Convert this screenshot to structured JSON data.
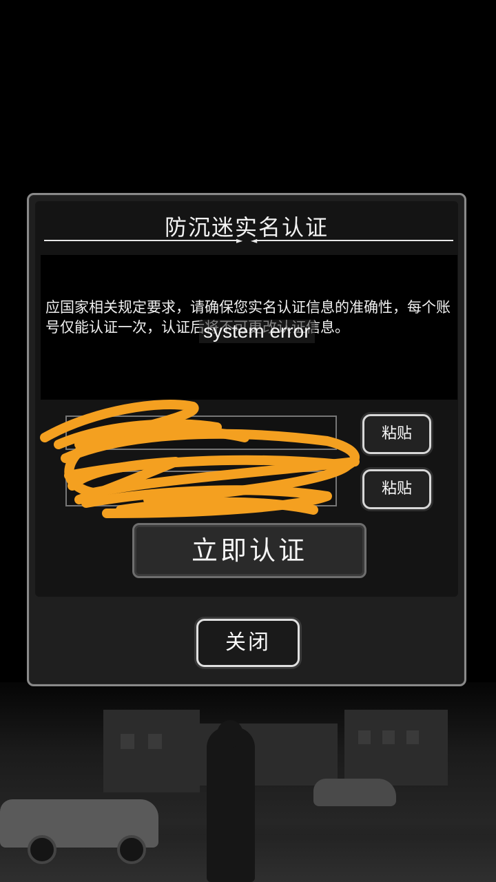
{
  "dialog": {
    "title": "防沉迷实名认证",
    "notice": "应国家相关规定要求，请确保您实名认证信息的准确性，每个账号仅能认证一次，认证后将不可更改认证信息。",
    "toast": "system error",
    "fields": {
      "name_placeholder": "",
      "id_placeholder": ""
    },
    "paste_label_1": "粘贴",
    "paste_label_2": "粘贴",
    "verify_label": "立即认证",
    "close_label": "关闭"
  },
  "colors": {
    "scribble": "#f4a020",
    "border": "#8a8a8a",
    "background": "#000000"
  }
}
